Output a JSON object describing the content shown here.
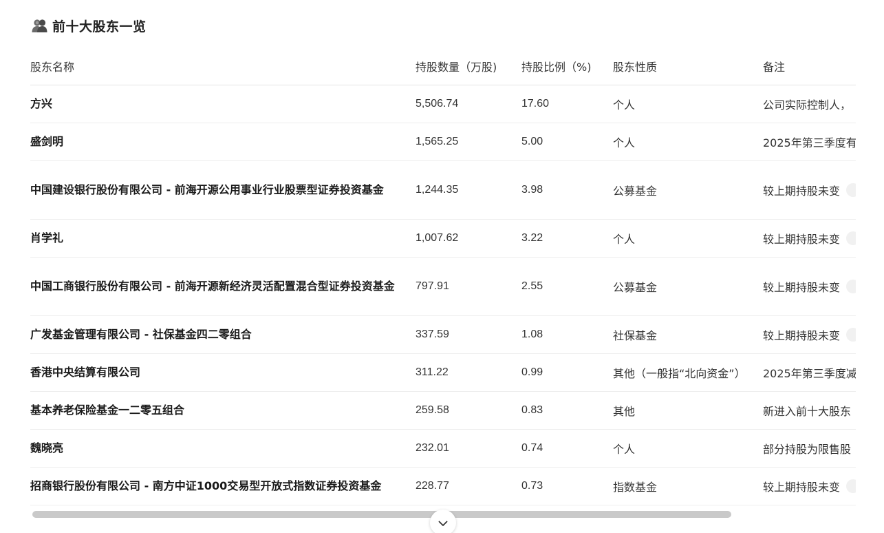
{
  "section": {
    "title": "前十大股东一览",
    "icon": "shareholders-icon"
  },
  "table": {
    "columns": [
      "股东名称",
      "持股数量（万股)",
      "持股比例（%)",
      "股东性质",
      "备注"
    ],
    "rows": [
      {
        "name": "方兴",
        "qty": "5,506.74",
        "pct": "17.60",
        "type": "个人",
        "note": "公司实际控制人，"
      },
      {
        "name": "盛剑明",
        "qty": "1,565.25",
        "pct": "5.00",
        "type": "个人",
        "note": "2025年第三季度有"
      },
      {
        "name": "中国建设银行股份有限公司 - 前海开源公用事业行业股票型证券投资基金",
        "qty": "1,244.35",
        "pct": "3.98",
        "type": "公募基金",
        "note": "较上期持股未变"
      },
      {
        "name": "肖学礼",
        "qty": "1,007.62",
        "pct": "3.22",
        "type": "个人",
        "note": "较上期持股未变"
      },
      {
        "name": "中国工商银行股份有限公司 - 前海开源新经济灵活配置混合型证券投资基金",
        "qty": "797.91",
        "pct": "2.55",
        "type": "公募基金",
        "note": "较上期持股未变"
      },
      {
        "name": "广发基金管理有限公司 - 社保基金四二零组合",
        "qty": "337.59",
        "pct": "1.08",
        "type": "社保基金",
        "note": "较上期持股未变"
      },
      {
        "name": "香港中央结算有限公司",
        "qty": "311.22",
        "pct": "0.99",
        "type": "其他（一般指“北向资金”）",
        "note": "2025年第三季度减"
      },
      {
        "name": "基本养老保险基金一二零五组合",
        "qty": "259.58",
        "pct": "0.83",
        "type": "其他",
        "note": "新进入前十大股东"
      },
      {
        "name": "魏晓亮",
        "qty": "232.01",
        "pct": "0.74",
        "type": "个人",
        "note": "部分持股为限售股"
      },
      {
        "name": "招商银行股份有限公司 - 南方中证1000交易型开放式指数证券投资基金",
        "qty": "228.77",
        "pct": "0.73",
        "type": "指数基金",
        "note": "较上期持股未变"
      }
    ]
  },
  "scroll": {
    "expand_icon": "chevron-down-icon"
  }
}
